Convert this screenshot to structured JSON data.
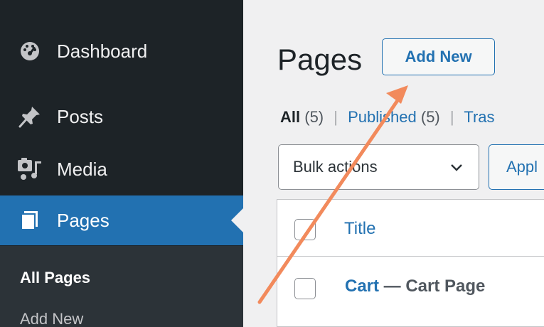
{
  "sidebar": {
    "items": [
      {
        "label": "Dashboard",
        "icon": "dashboard-icon"
      },
      {
        "label": "Posts",
        "icon": "pin-icon"
      },
      {
        "label": "Media",
        "icon": "media-icon"
      },
      {
        "label": "Pages",
        "icon": "pages-icon",
        "active": true
      }
    ],
    "submenu": [
      {
        "label": "All Pages",
        "current": true
      },
      {
        "label": "Add New"
      }
    ]
  },
  "main": {
    "title": "Pages",
    "add_new_label": "Add New",
    "filters": {
      "all_label": "All",
      "all_count": "(5)",
      "published_label": "Published",
      "published_count": "(5)",
      "trash_label": "Tras"
    },
    "bulk_actions_label": "Bulk actions",
    "apply_label": "Appl",
    "table": {
      "header_title": "Title",
      "rows": [
        {
          "title": "Cart",
          "state": " — Cart Page"
        }
      ]
    }
  },
  "colors": {
    "sidebar_bg": "#1d2327",
    "accent": "#2271b1",
    "annotation_arrow": "#f28a5c"
  }
}
